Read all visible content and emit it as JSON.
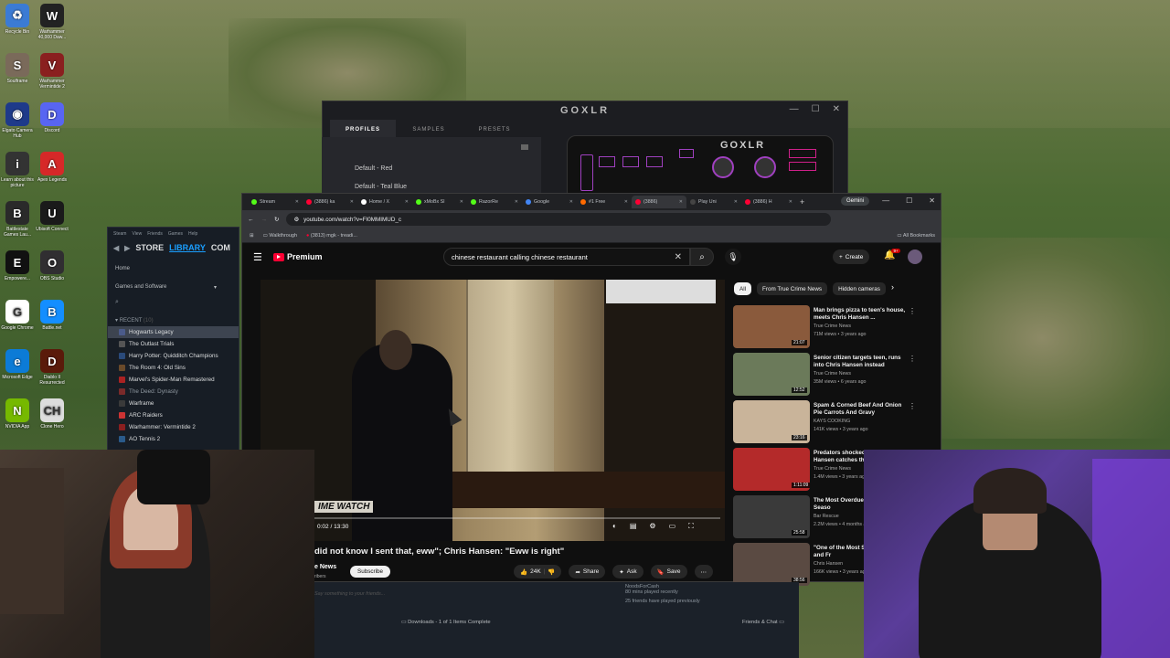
{
  "desktop": {
    "icons": [
      {
        "label": "Recycle Bin",
        "color": "#3b7bd4",
        "glyph": "♻"
      },
      {
        "label": "Warhammer 40,000 Daw...",
        "color": "#222",
        "glyph": "W"
      },
      {
        "label": "Soulframe",
        "color": "#7a6a5a",
        "glyph": "S"
      },
      {
        "label": "Warhammer Vermintide 2",
        "color": "#8a1f1f",
        "glyph": "V"
      },
      {
        "label": "Elgato Camera Hub",
        "color": "#1e3a8a",
        "glyph": "◉"
      },
      {
        "label": "Discord",
        "color": "#5865f2",
        "glyph": "D"
      },
      {
        "label": "Learn about this picture",
        "color": "#333",
        "glyph": "i"
      },
      {
        "label": "Apex Legends",
        "color": "#d62828",
        "glyph": "A"
      },
      {
        "label": "Battlestate Games Lau...",
        "color": "#2a2a2a",
        "glyph": "B"
      },
      {
        "label": "Ubisoft Connect",
        "color": "#1a1a1a",
        "glyph": "U"
      },
      {
        "label": "Empowere...",
        "color": "#111",
        "glyph": "E"
      },
      {
        "label": "OBS Studio",
        "color": "#302e31",
        "glyph": "O"
      },
      {
        "label": "Google Chrome",
        "color": "#ffffff",
        "glyph": "G"
      },
      {
        "label": "Battle.net",
        "color": "#148eff",
        "glyph": "B"
      },
      {
        "label": "Microsoft Edge",
        "color": "#0c7bd6",
        "glyph": "e"
      },
      {
        "label": "Diablo II Resurrected",
        "color": "#5a1a0a",
        "glyph": "D"
      },
      {
        "label": "NVIDIA App",
        "color": "#76b900",
        "glyph": "N"
      },
      {
        "label": "Clone Hero",
        "color": "#ddd",
        "glyph": "CH"
      }
    ]
  },
  "goxlr": {
    "title": "GOXLR",
    "tabs": [
      "PROFILES",
      "SAMPLES",
      "PRESETS"
    ],
    "profiles": [
      "Default - Red",
      "Default - Teal Blue"
    ],
    "device_logo": "GOXLR"
  },
  "steam": {
    "menu": [
      "Steam",
      "View",
      "Friends",
      "Games",
      "Help"
    ],
    "nav": [
      "STORE",
      "LIBRARY",
      "COM"
    ],
    "home": "Home",
    "filter": "Games and Software",
    "recent_label": "RECENT",
    "recent_suffix": "(10)",
    "games": [
      "Hogwarts Legacy",
      "The Outlast Trials",
      "Harry Potter: Quidditch Champions",
      "The Room 4: Old Sins",
      "Marvel's Spider-Man Remastered",
      "The Deed: Dynasty",
      "Warframe",
      "ARC Raiders",
      "Warhammer: Vermintide 2",
      "AO Tennis 2"
    ],
    "bottom": {
      "chat_placeholder": "Say something to your friends...",
      "friend_name": "NoodsForCash",
      "friend_status": "80 mins played recently",
      "friends_played": "25 friends have played previously",
      "downloads": "Downloads - 1 of 1 Items Complete",
      "friends_chat": "Friends & Chat"
    }
  },
  "browser": {
    "tabs": [
      {
        "label": "Stream",
        "color": "#53fc18"
      },
      {
        "label": "(3886) ka",
        "color": "#ff0033"
      },
      {
        "label": "Home / X",
        "color": "#ffffff"
      },
      {
        "label": "xMoBx Sl",
        "color": "#53fc18"
      },
      {
        "label": "RazorRe",
        "color": "#53fc18"
      },
      {
        "label": "Google",
        "color": "#4285f4"
      },
      {
        "label": "#1 Free",
        "color": "#ff6a00"
      },
      {
        "label": "(3886)",
        "color": "#ff0033"
      },
      {
        "label": "Play Uni",
        "color": "#444"
      },
      {
        "label": "(3886) H",
        "color": "#ff0033"
      }
    ],
    "new_tab": "+",
    "gemini": "Gemini",
    "url": "youtube.com/watch?v=FI0MMIMUD_c",
    "bookmarks": [
      "Walkthrough",
      "(3813) mgk - treadi..."
    ],
    "all_bookmarks": "All Bookmarks"
  },
  "youtube": {
    "logo_text": "Premium",
    "search_query": "chinese restaurant calling chinese restaurant",
    "create_label": "Create",
    "notif_count": "9+",
    "video_banner": "IME WATCH",
    "time": "0:02 / 13:30",
    "progress": 0.0025,
    "title": "did not know I sent that, eww\"; Chris Hansen: \"Eww is right\"",
    "channel": "e News",
    "channel_subs": "ribers",
    "subscribe": "Subscribe",
    "likes": "24K",
    "share": "Share",
    "ask": "Ask",
    "save": "Save",
    "chips": [
      "All",
      "From True Crime News",
      "Hidden cameras"
    ],
    "recommendations": [
      {
        "title": "Man brings pizza to teen's house, meets Chris Hansen ...",
        "channel": "True Crime News",
        "meta": "71M views • 3 years ago",
        "duration": "21:07",
        "color": "#8a5a3c"
      },
      {
        "title": "Senior citizen targets teen, runs into Chris Hansen instead",
        "channel": "True Crime News",
        "meta": "35M views • 6 years ago",
        "duration": "12:52",
        "color": "#6b7a5a"
      },
      {
        "title": "Spam & Corned Beef And Onion Pie Carrots And Gravy",
        "channel": "KAYS COOKING",
        "meta": "141K views • 3 years ago",
        "duration": "23:16",
        "color": "#c9b49a"
      },
      {
        "title": "Predators shocked when Chris Hansen catches th",
        "channel": "True Crime News",
        "meta": "1.4M views • 3 years ago",
        "duration": "1:11:09",
        "color": "#b42a2a"
      },
      {
        "title": "The Most Overdue Bar Rescue Seaso",
        "channel": "Bar Rescue",
        "meta": "2.2M views • 4 months ago",
        "duration": "25:58",
        "color": "#3a3a3a"
      },
      {
        "title": "\"One of the Most S Surprising, and Fr",
        "channel": "Chris Hansen",
        "meta": "166K views • 3 years ago",
        "duration": "38:56",
        "color": "#5a4a42"
      }
    ]
  }
}
